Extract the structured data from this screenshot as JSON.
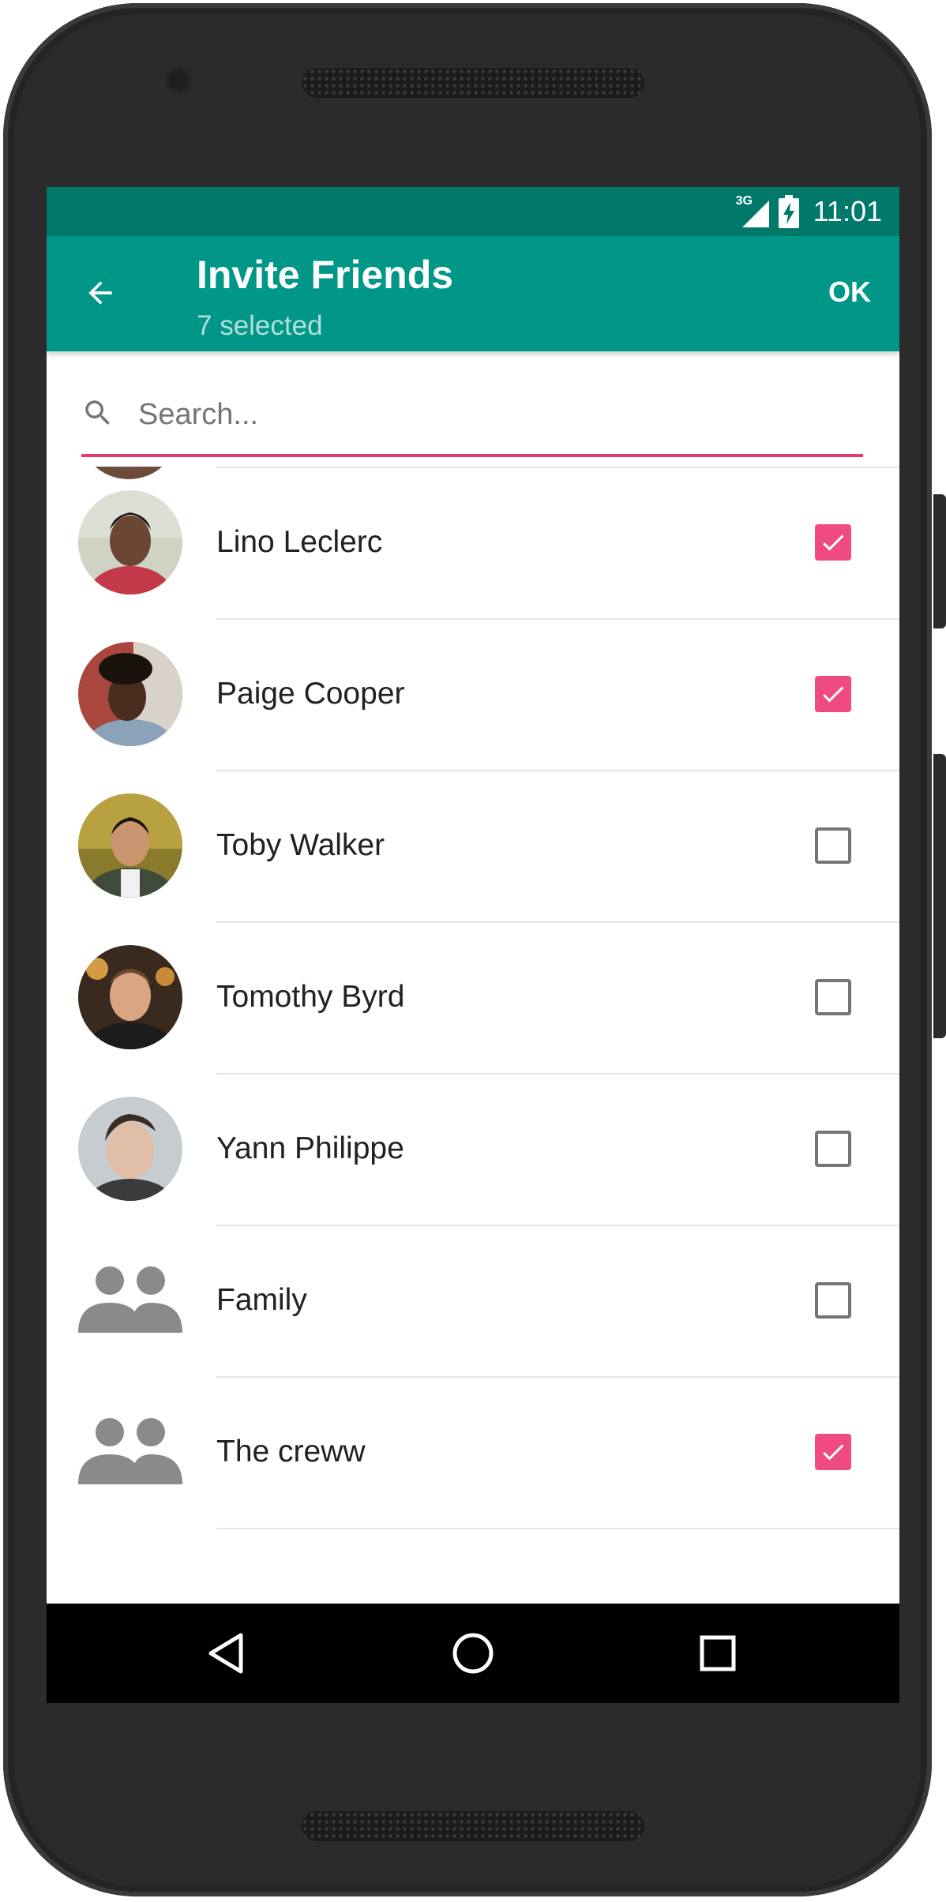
{
  "status_bar": {
    "network_label": "3G",
    "time": "11:01",
    "background_color": "#00796b"
  },
  "app_bar": {
    "title": "Invite Friends",
    "subtitle": "7 selected",
    "action_ok": "OK",
    "back_icon": "arrow-back-icon",
    "background_color": "#009688"
  },
  "search": {
    "placeholder": "Search...",
    "value": "",
    "icon": "search-icon",
    "underline_color": "#e63a7a"
  },
  "contacts": [
    {
      "name": "Lino Leclerc",
      "kind": "person",
      "checked": true
    },
    {
      "name": "Paige Cooper",
      "kind": "person",
      "checked": true
    },
    {
      "name": "Toby Walker",
      "kind": "person",
      "checked": false
    },
    {
      "name": "Tomothy Byrd",
      "kind": "person",
      "checked": false
    },
    {
      "name": "Yann Philippe",
      "kind": "person",
      "checked": false
    },
    {
      "name": "Family",
      "kind": "group",
      "checked": false
    },
    {
      "name": "The creww",
      "kind": "group",
      "checked": true
    }
  ],
  "colors": {
    "checkbox_checked": "#ef4a82",
    "group_icon": "#8a8a8a"
  },
  "nav_bar": {
    "back_icon": "nav-back-icon",
    "home_icon": "nav-home-icon",
    "recents_icon": "nav-recents-icon"
  }
}
